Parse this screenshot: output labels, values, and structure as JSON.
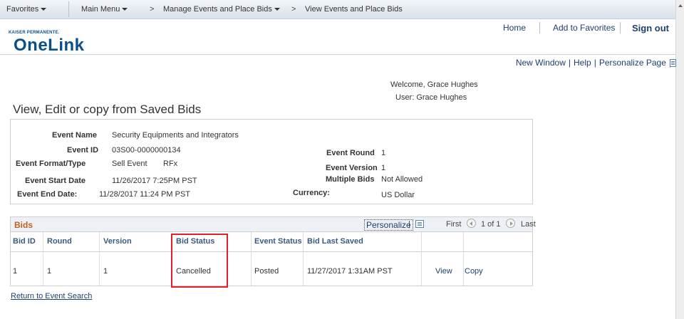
{
  "menu": {
    "favorites": "Favorites",
    "main_menu": "Main Menu",
    "crumb_sep": ">",
    "breadcrumb": [
      "Manage Events and Place Bids",
      "View Events and Place Bids"
    ]
  },
  "header": {
    "logo_top": "KAISER PERMANENTE.",
    "logo_main": "OneLink",
    "links": {
      "home": "Home",
      "add_to_favorites": "Add to Favorites",
      "sign_out": "Sign out"
    }
  },
  "util_links": {
    "new_window": "New Window",
    "help": "Help",
    "personalize_page": "Personalize Page",
    "sep": "|"
  },
  "welcome": "Welcome, Grace Hughes",
  "user": "User: Grace Hughes",
  "page_title": "View, Edit or copy from Saved Bids",
  "event": {
    "name_label": "Event Name",
    "name": "Security Equipments and Integrators",
    "id_label": "Event ID",
    "id": "03S00-0000000134",
    "format_label": "Event Format/Type",
    "format": "Sell Event",
    "type": "RFx",
    "start_label": "Event Start Date",
    "start": "11/26/2017  7:25PM PST",
    "end_label": "Event End Date:",
    "end": "11/28/2017 11:24 PM PST",
    "round_label": "Event Round",
    "round": "1",
    "version_label": "Event Version",
    "version": "1",
    "multiple_label": "Multiple Bids",
    "multiple": "Not Allowed",
    "currency_label": "Currency:",
    "currency": "US Dollar"
  },
  "bids": {
    "title": "Bids",
    "personalize": "Personalize",
    "nav_sep": "|",
    "first": "First",
    "range": "1 of 1",
    "last": "Last",
    "columns": [
      "Bid ID",
      "Round",
      "Version",
      "Bid Status",
      "Event Status",
      "Bid Last Saved"
    ],
    "rows": [
      {
        "bid_id": "1",
        "round": "1",
        "version": "1",
        "bid_status": "Cancelled",
        "event_status": "Posted",
        "last_saved": "11/27/2017  1:31AM PST",
        "view": "View",
        "copy": "Copy"
      }
    ]
  },
  "return_link": "Return to Event Search",
  "colors": {
    "brand": "#0a4f8a",
    "section_title": "#c0601c",
    "highlight": "#e0202a",
    "link": "#1f3f6e"
  }
}
